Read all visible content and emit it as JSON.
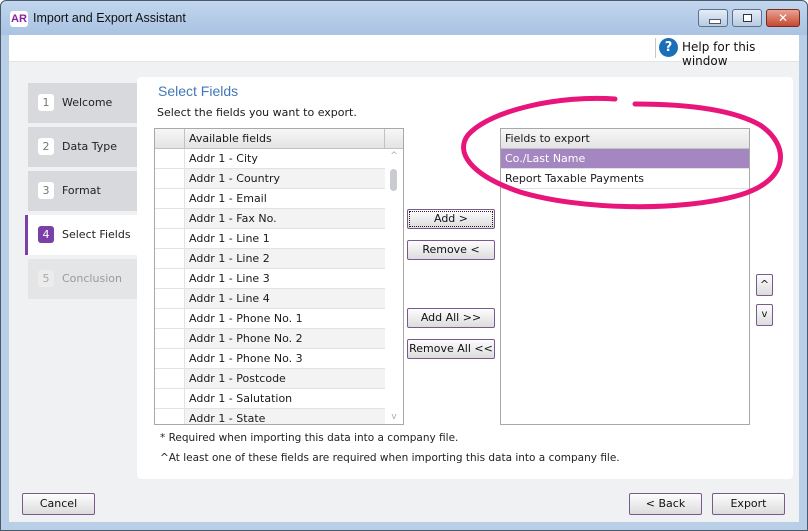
{
  "window": {
    "app_icon": "AR",
    "title": "Import and Export Assistant",
    "controls": {
      "minimize": "minimize-icon",
      "maximize": "maximize-icon",
      "close": "close-icon",
      "close_glyph": "✕"
    }
  },
  "help": {
    "icon_glyph": "?",
    "label": "Help for this window"
  },
  "steps": [
    {
      "num": "1",
      "label": "Welcome",
      "state": "done"
    },
    {
      "num": "2",
      "label": "Data Type",
      "state": "done"
    },
    {
      "num": "3",
      "label": "Format",
      "state": "done"
    },
    {
      "num": "4",
      "label": "Select Fields",
      "state": "active"
    },
    {
      "num": "5",
      "label": "Conclusion",
      "state": "disabled"
    }
  ],
  "panel": {
    "title": "Select Fields",
    "subtitle": "Select the fields you want to export."
  },
  "available_fields": {
    "header": "Available fields",
    "items": [
      "Addr 1 - City",
      "Addr 1 - Country",
      "Addr 1 - Email",
      "Addr 1 - Fax No.",
      "Addr 1 - Line 1",
      "Addr 1 - Line 2",
      "Addr 1 - Line 3",
      "Addr 1 - Line 4",
      "Addr 1 - Phone No. 1",
      "Addr 1 - Phone No. 2",
      "Addr 1 - Phone No. 3",
      "Addr 1 - Postcode",
      "Addr 1 - Salutation",
      "Addr 1 - State"
    ],
    "scroll_up": "^",
    "scroll_down": "v"
  },
  "buttons": {
    "add": "Add >",
    "remove": "Remove <",
    "add_all": "Add All >>",
    "remove_all": "Remove All <<",
    "move_up": "^",
    "move_down": "v",
    "cancel": "Cancel",
    "back": "< Back",
    "export": "Export"
  },
  "export_fields": {
    "header": "Fields to export",
    "items": [
      {
        "label": "Co./Last Name",
        "selected": true
      },
      {
        "label": "Report Taxable Payments",
        "selected": false
      }
    ]
  },
  "notes": [
    "* Required when importing this data into a company file.",
    "^At least one of these fields are required when importing this data into a company file."
  ],
  "annotation": {
    "color": "#e8157a"
  }
}
